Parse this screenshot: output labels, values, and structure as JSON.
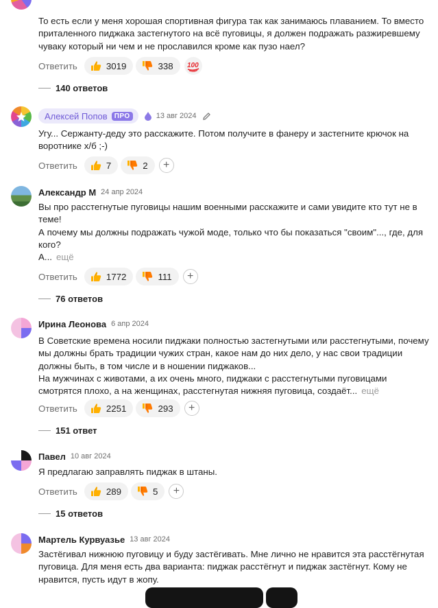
{
  "colors": {
    "like": "#ffb000",
    "dislike": "#ffb000",
    "pro_badge": "#8b78e8",
    "author_chip": "#ebe9fb",
    "link_muted": "#9a9a9a"
  },
  "reply_label": "Ответить",
  "more_label": "ещё",
  "comments": [
    {
      "author": "",
      "date": "",
      "text": [
        "То есть если у меня хорошая спортивная фигура так как занимаюсь плаванием. То вместо приталенного пиджака застегнутого на всё пуговицы, я должен подражать разжиревшему чуваку который ни чем и не прославился кроме как пузо наел?"
      ],
      "likes": "3019",
      "dislikes": "338",
      "reaction_icon": "hundred-points-emoji",
      "replies": "140 ответов"
    },
    {
      "author": "Алексей Попов",
      "badge": "ПРО",
      "date": "13 авг 2024",
      "text": [
        "Угу... Сержанту-деду это расскажите. Потом получите в фанеру и застегните крючок на воротнике х/б ;-)"
      ],
      "likes": "7",
      "dislikes": "2"
    },
    {
      "author": "Александр М",
      "date": "24 апр 2024",
      "text": [
        "Вы про расстегнутые пуговицы нашим военными расскажите и сами увидите кто тут не в теме!",
        "А почему мы должны подражать чужой моде, только что бы показаться \"своим\"..., где, для кого?",
        "А..."
      ],
      "likes": "1772",
      "dislikes": "111",
      "replies": "76 ответов"
    },
    {
      "author": "Ирина Леонова",
      "date": "6 апр 2024",
      "text": [
        "В Советские времена носили пиджаки полностью застегнутыми или расстегнутыми, почему мы должны брать традиции чужих стран, какое нам до них дело, у нас свои традиции должны быть, в том числе и в ношении пиджаков...",
        "На мужчинах с животами, а их очень много, пиджаки с расстегнутыми пуговицами смотрятся плохо, а на женщинах, расстегнутая нижняя пуговица, создаёт..."
      ],
      "likes": "2251",
      "dislikes": "293",
      "replies": "151 ответ"
    },
    {
      "author": "Павел",
      "date": "10 авг 2024",
      "text": [
        "Я предлагаю заправлять пиджак в штаны."
      ],
      "likes": "289",
      "dislikes": "5",
      "replies": "15 ответов"
    },
    {
      "author": "Мартель Курвуазье",
      "date": "13 авг 2024",
      "text": [
        "Застёгивал нижнюю пуговицу и буду застёгивать. Мне лично не нравится эта расстёгнутая пуговица. Для меня есть два варианта: пиджак расстёгнут и пиджак застёгнут. Кому не нравится, пусть идут в жопу."
      ]
    }
  ]
}
